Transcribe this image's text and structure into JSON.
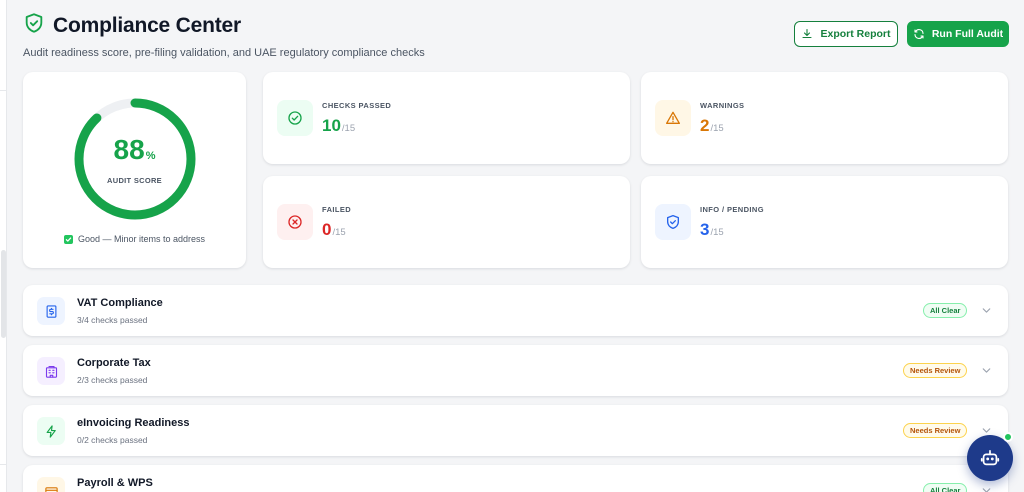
{
  "header": {
    "title": "Compliance Center",
    "subtitle": "Audit readiness score, pre-filing validation, and UAE regulatory compliance checks",
    "export_label": "Export Report",
    "audit_label": "Run Full Audit"
  },
  "score": {
    "value": "88",
    "value_fraction": 0.88,
    "unit": "%",
    "label": "AUDIT SCORE",
    "status": "Good — Minor items to address",
    "color": "#16a34a",
    "track_color": "#eef0f3"
  },
  "stats": {
    "passed": {
      "label": "CHECKS PASSED",
      "value": "10",
      "total": "/15",
      "color": "#16a34a",
      "icon": "check-circle-icon"
    },
    "warnings": {
      "label": "WARNINGS",
      "value": "2",
      "total": "/15",
      "color": "#d97706",
      "icon": "warning-triangle-icon"
    },
    "failed": {
      "label": "FAILED",
      "value": "0",
      "total": "/15",
      "color": "#dc2626",
      "icon": "x-circle-icon"
    },
    "info": {
      "label": "INFO / PENDING",
      "value": "3",
      "total": "/15",
      "color": "#2563eb",
      "icon": "shield-check-icon"
    }
  },
  "sections": [
    {
      "title": "VAT Compliance",
      "subtitle": "3/4 checks passed",
      "badge": "All Clear",
      "status": "clear",
      "icon": "dollar-receipt-icon"
    },
    {
      "title": "Corporate Tax",
      "subtitle": "2/3 checks passed",
      "badge": "Needs Review",
      "status": "review",
      "icon": "building-icon"
    },
    {
      "title": "eInvoicing Readiness",
      "subtitle": "0/2 checks passed",
      "badge": "Needs Review",
      "status": "review",
      "icon": "lightning-icon"
    },
    {
      "title": "Payroll & WPS",
      "subtitle": "",
      "badge": "All Clear",
      "status": "clear",
      "icon": "payroll-icon"
    }
  ]
}
